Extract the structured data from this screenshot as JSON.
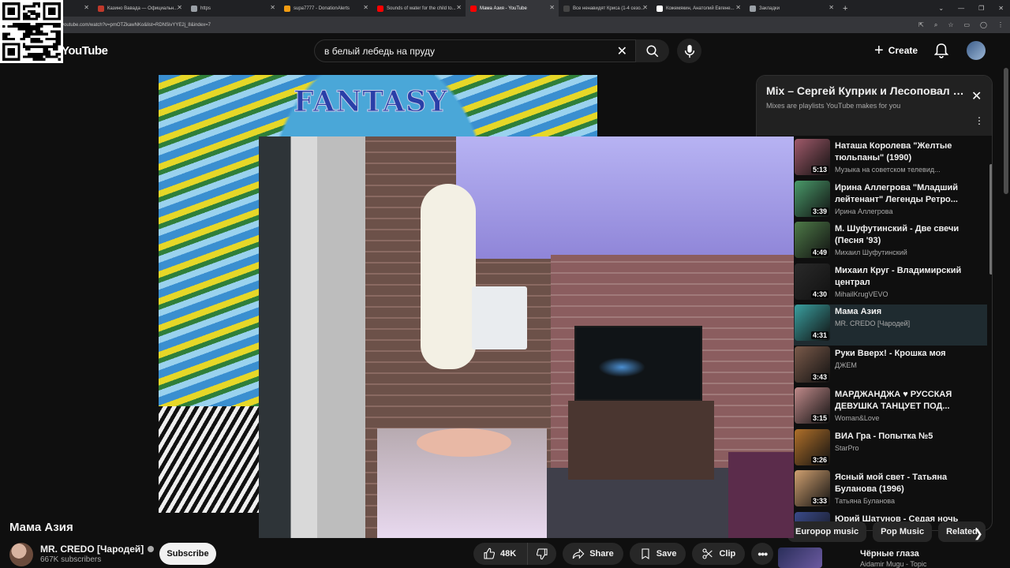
{
  "browser": {
    "tabs": [
      {
        "label": "- более 5000 ...",
        "color": "#3c8cff",
        "active": false
      },
      {
        "label": "Казино Вавада — Официальн...",
        "color": "#c0392b",
        "active": false
      },
      {
        "label": "https",
        "color": "#9aa0a6",
        "active": false
      },
      {
        "label": "supa7777 - DonationAlerts",
        "color": "#f39c12",
        "active": false
      },
      {
        "label": "Sounds of water for the child to...",
        "color": "#ff0000",
        "active": false
      },
      {
        "label": "Мама Азия - YouTube",
        "color": "#ff0000",
        "active": true
      },
      {
        "label": "Все ненавидят Криса (1-4 сезо...",
        "color": "#444",
        "active": false
      },
      {
        "label": "Кожемякин, Анатолий Евгене...",
        "color": "#ffffff",
        "active": false
      },
      {
        "label": "Закладки",
        "color": "#9aa0a6",
        "active": false
      }
    ],
    "new_tab": "+",
    "url": "youtube.com/watch?v=pmOTZkawNKo&list=RDNSivYYE2j_8&index=7"
  },
  "header": {
    "logo": "YouTube",
    "search_query": "в белый лебедь на пруду",
    "create_label": "Create"
  },
  "video": {
    "overlay_text": "FANTASY",
    "title": "Мама Азия",
    "channel": "MR. CREDO [Чародей]",
    "subscribers": "667K subscribers",
    "subscribe_label": "Subscribe",
    "likes": "48K",
    "share_label": "Share",
    "save_label": "Save",
    "clip_label": "Clip"
  },
  "playlist": {
    "title": "Mix – Сергей Куприк и Лесоповал –...",
    "subtitle": "Mixes are playlists YouTube makes for you",
    "items": [
      {
        "name": "Наташа Королева \"Желтые тюльпаны\" (1990)",
        "channel": "Музыка на советском телевид...",
        "duration": "5:13",
        "thumb": "#a05a6a",
        "current": false
      },
      {
        "name": "Ирина Аллегрова \"Младший лейтенант\" Легенды Ретро...",
        "channel": "Ирина Аллегрова",
        "duration": "3:39",
        "thumb": "#4a9a6a",
        "current": false
      },
      {
        "name": "М. Шуфутинский - Две свечи (Песня '93)",
        "channel": "Михаил Шуфутинский",
        "duration": "4:49",
        "thumb": "#4e7a48",
        "current": false
      },
      {
        "name": "Михаил Круг - Владимирский централ",
        "channel": "MihailKrugVEVO",
        "duration": "4:30",
        "thumb": "#2a2a2a",
        "current": false
      },
      {
        "name": "Мама Азия",
        "channel": "MR. CREDO [Чародей]",
        "duration": "4:31",
        "thumb": "#3aa0a0",
        "current": true
      },
      {
        "name": "Руки Вверх! - Крошка моя",
        "channel": "ДЖЕМ",
        "duration": "3:43",
        "thumb": "#7a5a4a",
        "current": false
      },
      {
        "name": "МАРДЖАНДЖА ♥ РУССКАЯ ДЕВУШКА ТАНЦУЕТ ПОД...",
        "channel": "Woman&Love",
        "duration": "3:15",
        "thumb": "#c08a8a",
        "current": false
      },
      {
        "name": "ВИА Гра - Попытка №5",
        "channel": "StarPro",
        "duration": "3:26",
        "thumb": "#b0702a",
        "current": false
      },
      {
        "name": "Ясный мой свет - Татьяна Буланова (1996)",
        "channel": "Татьяна Буланова",
        "duration": "3:33",
        "thumb": "#d0a070",
        "current": false
      },
      {
        "name": "Юрий Шатунов - Седая ночь",
        "channel": "",
        "duration": "",
        "thumb": "#3a4a8a",
        "current": false
      }
    ]
  },
  "chips": [
    "Europop music",
    "Pop Music",
    "Related"
  ],
  "recommendation": {
    "title": "Чёрные глаза",
    "channel": "Aidamir Mugu - Topic"
  }
}
